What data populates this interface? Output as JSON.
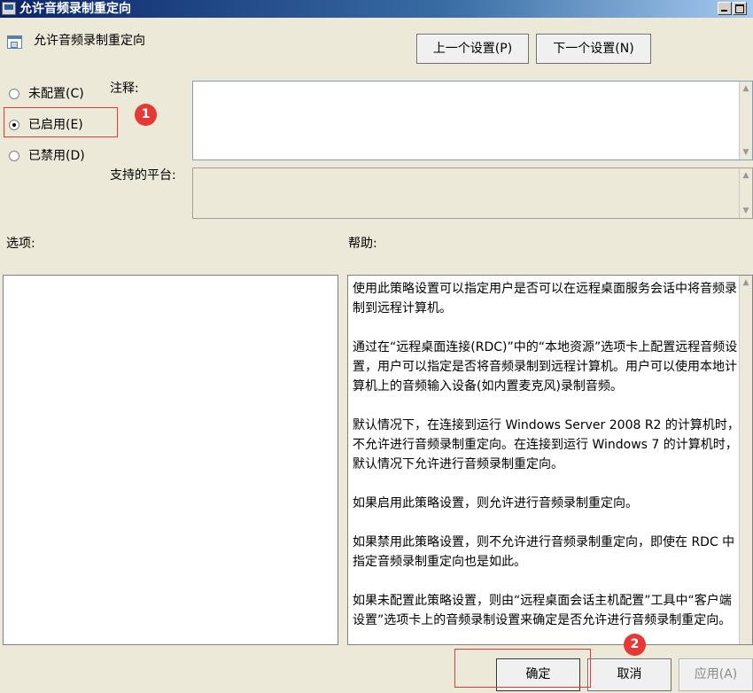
{
  "window": {
    "title": "允许音频录制重定向"
  },
  "header": {
    "policy_title": "允许音频录制重定向",
    "prev_button": "上一个设置(P)",
    "next_button": "下一个设置(N)"
  },
  "state": {
    "options": [
      "未配置(C)",
      "已启用(E)",
      "已禁用(D)"
    ],
    "selected": "已启用(E)"
  },
  "labels": {
    "comment": "注释:",
    "platform": "支持的平台:",
    "options": "选项:",
    "help": "帮助:"
  },
  "fields": {
    "comment_value": "",
    "platform_value": ""
  },
  "help_text": [
    "使用此策略设置可以指定用户是否可以在远程桌面服务会话中将音频录制到远程计算机。",
    "通过在“远程桌面连接(RDC)”中的“本地资源”选项卡上配置远程音频设置，用户可以指定是否将音频录制到远程计算机。用户可以使用本地计算机上的音频输入设备(如内置麦克风)录制音频。",
    "默认情况下，在连接到运行 Windows Server 2008 R2 的计算机时，不允许进行音频录制重定向。在连接到运行 Windows 7 的计算机时，默认情况下允许进行音频录制重定向。",
    "如果启用此策略设置，则允许进行音频录制重定向。",
    "如果禁用此策略设置，则不允许进行音频录制重定向，即使在 RDC 中指定音频录制重定向也是如此。",
    "如果未配置此策略设置，则由“远程桌面会话主机配置”工具中“客户端设置”选项卡上的音频录制设置来确定是否允许进行音频录制重定向。"
  ],
  "annotations": {
    "badge_1": "1",
    "badge_2": "2",
    "highlight_color": "#e53935"
  },
  "footer": {
    "ok": "确定",
    "cancel": "取消",
    "apply": "应用(A)"
  }
}
